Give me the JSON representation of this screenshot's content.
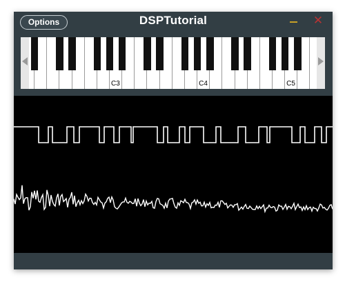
{
  "window": {
    "title": "DSPTutorial",
    "options_label": "Options",
    "minimize_icon": "minimize-icon",
    "close_icon": "close-icon",
    "close_glyph": "✕"
  },
  "keyboard": {
    "labels": {
      "c3": "C3",
      "c4": "C4",
      "c5": "C5",
      "partial": "2"
    },
    "scroll_left_icon": "chevron-left-icon",
    "scroll_right_icon": "chevron-right-icon"
  },
  "colors": {
    "background": "#323e44",
    "scope_background": "#000000",
    "trace": "#ffffff",
    "minimize": "#c8a027",
    "close": "#b83333"
  }
}
